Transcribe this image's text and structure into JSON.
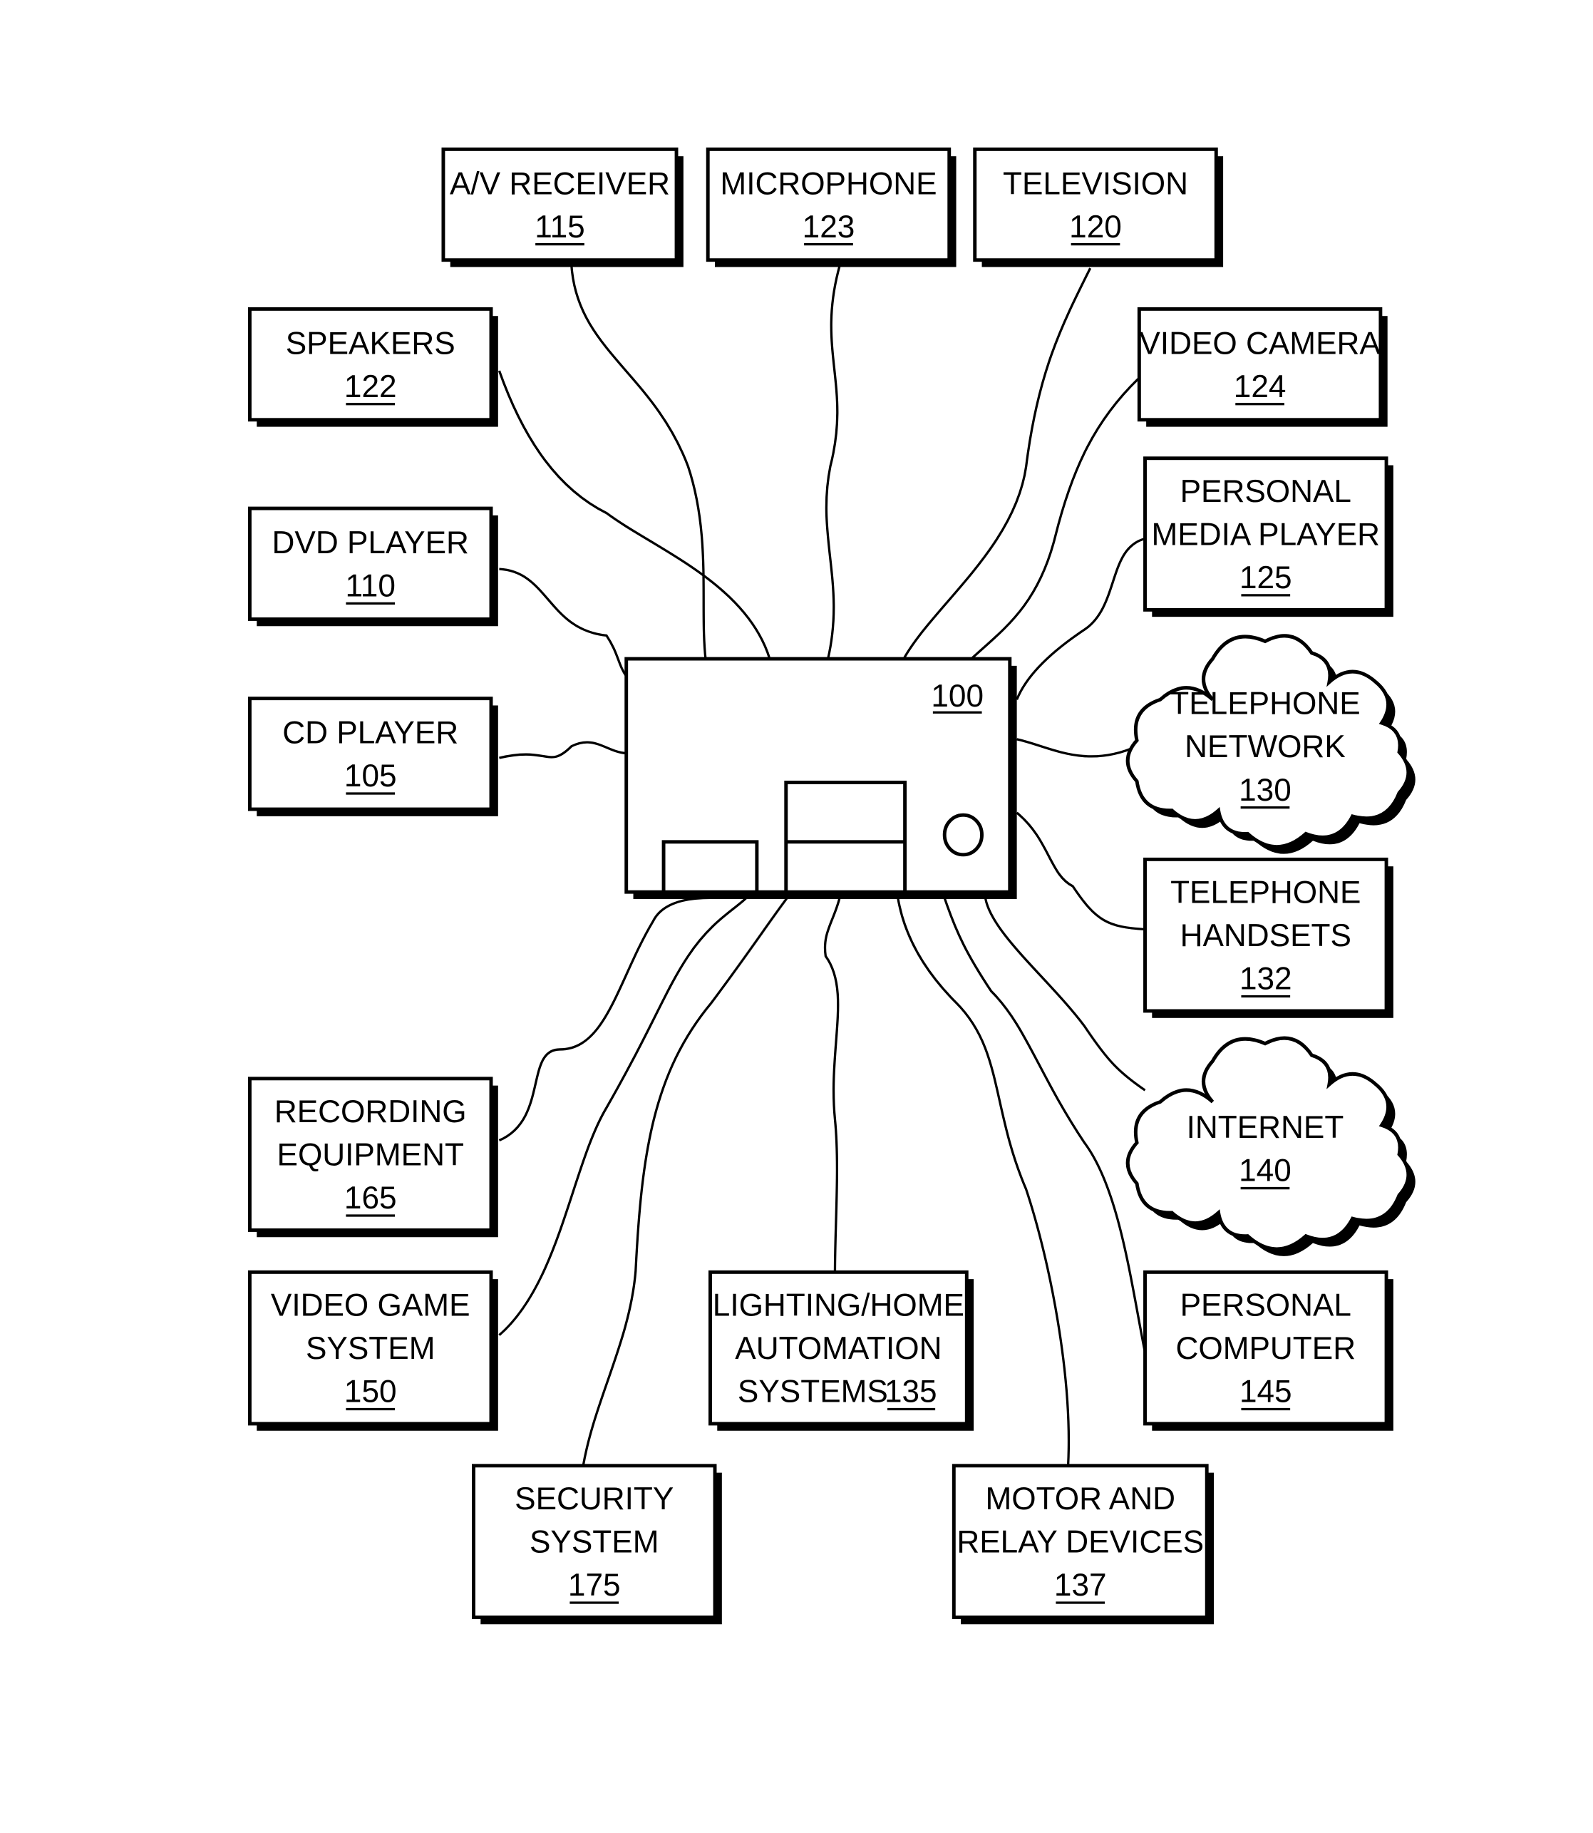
{
  "diagram": {
    "central_device": {
      "ref": "100"
    },
    "nodes": [
      {
        "id": "av-receiver",
        "lines": [
          "A/V RECEIVER"
        ],
        "ref": "115",
        "shape": "box"
      },
      {
        "id": "microphone",
        "lines": [
          "MICROPHONE"
        ],
        "ref": "123",
        "shape": "box"
      },
      {
        "id": "television",
        "lines": [
          "TELEVISION"
        ],
        "ref": "120",
        "shape": "box"
      },
      {
        "id": "speakers",
        "lines": [
          "SPEAKERS"
        ],
        "ref": "122",
        "shape": "box"
      },
      {
        "id": "video-camera",
        "lines": [
          "VIDEO CAMERA"
        ],
        "ref": "124",
        "shape": "box"
      },
      {
        "id": "dvd-player",
        "lines": [
          "DVD PLAYER"
        ],
        "ref": "110",
        "shape": "box"
      },
      {
        "id": "personal-media-player",
        "lines": [
          "PERSONAL",
          "MEDIA PLAYER"
        ],
        "ref": "125",
        "shape": "box"
      },
      {
        "id": "cd-player",
        "lines": [
          "CD PLAYER"
        ],
        "ref": "105",
        "shape": "box"
      },
      {
        "id": "telephone-network",
        "lines": [
          "TELEPHONE",
          "NETWORK"
        ],
        "ref": "130",
        "shape": "cloud"
      },
      {
        "id": "telephone-handsets",
        "lines": [
          "TELEPHONE",
          "HANDSETS"
        ],
        "ref": "132",
        "shape": "box"
      },
      {
        "id": "internet",
        "lines": [
          "INTERNET"
        ],
        "ref": "140",
        "shape": "cloud"
      },
      {
        "id": "recording-equipment",
        "lines": [
          "RECORDING",
          "EQUIPMENT"
        ],
        "ref": "165",
        "shape": "box"
      },
      {
        "id": "video-game-system",
        "lines": [
          "VIDEO GAME",
          "SYSTEM"
        ],
        "ref": "150",
        "shape": "box"
      },
      {
        "id": "lighting-home-automation",
        "lines": [
          "LIGHTING/HOME",
          "AUTOMATION",
          "SYSTEMS"
        ],
        "ref": "135",
        "ref_inline": true,
        "shape": "box"
      },
      {
        "id": "personal-computer",
        "lines": [
          "PERSONAL",
          "COMPUTER"
        ],
        "ref": "145",
        "shape": "box"
      },
      {
        "id": "security-system",
        "lines": [
          "SECURITY",
          "SYSTEM"
        ],
        "ref": "175",
        "shape": "box"
      },
      {
        "id": "motor-relay-devices",
        "lines": [
          "MOTOR AND",
          "RELAY DEVICES"
        ],
        "ref": "137",
        "shape": "box"
      }
    ]
  }
}
